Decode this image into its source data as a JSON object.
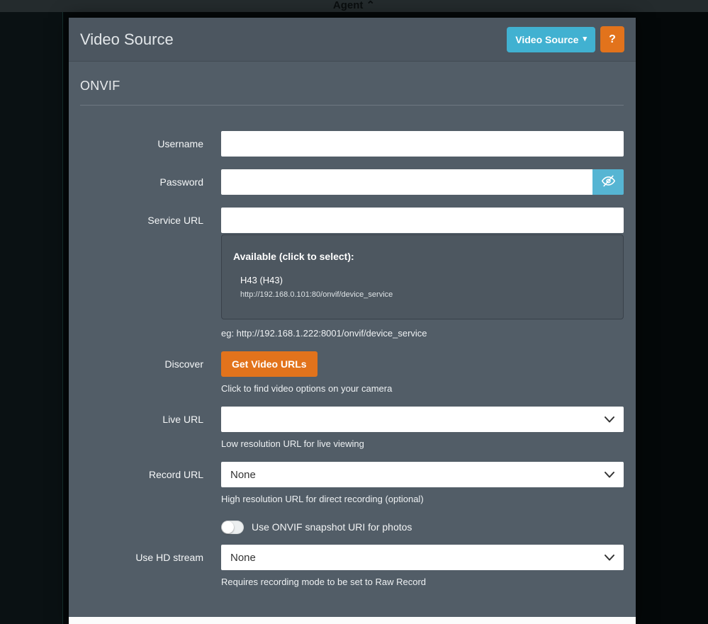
{
  "topbar": {
    "label": "Agent",
    "chevron_up_icon": "⌃"
  },
  "modal": {
    "title": "Video Source",
    "video_source_button": "Video Source",
    "caret_down_icon": "▾",
    "help_button": "?",
    "section_title": "ONVIF",
    "colors": {
      "accent_teal": "#41b1d1",
      "accent_orange": "#e2731c",
      "panel_background": "#525d67"
    },
    "form": {
      "username": {
        "label": "Username",
        "value": ""
      },
      "password": {
        "label": "Password",
        "value": ""
      },
      "service_url": {
        "label": "Service URL",
        "value": "",
        "available_title": "Available (click to select):",
        "devices": [
          {
            "name": "H43 (H43)",
            "url": "http://192.168.0.101:80/onvif/device_service"
          }
        ],
        "hint": "eg: http://192.168.1.222:8001/onvif/device_service"
      },
      "discover": {
        "label": "Discover",
        "button_label": "Get Video URLs",
        "hint": "Click to find video options on your camera"
      },
      "live_url": {
        "label": "Live URL",
        "value": "",
        "hint": "Low resolution URL for live viewing"
      },
      "record_url": {
        "label": "Record URL",
        "value": "None",
        "hint": "High resolution URL for direct recording (optional)"
      },
      "snapshot": {
        "label": "Use ONVIF snapshot URI for photos",
        "state": "off"
      },
      "hd_stream": {
        "label": "Use HD stream",
        "value": "None",
        "hint": "Requires recording mode to be set to Raw Record"
      }
    }
  }
}
